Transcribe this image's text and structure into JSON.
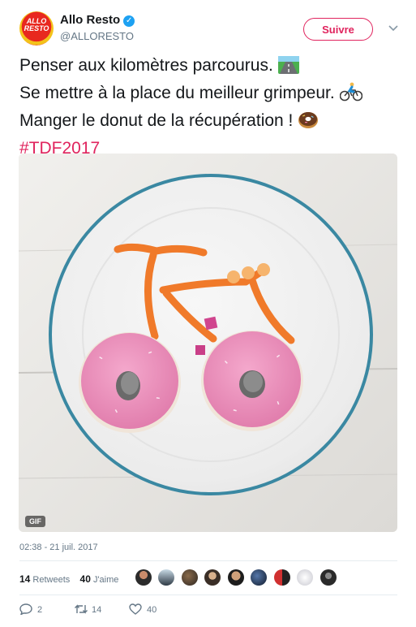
{
  "tweet": {
    "author": {
      "display_name": "Allo Resto",
      "handle": "@ALLORESTO",
      "avatar_text_1": "ALLO",
      "avatar_text_2": "RESTO",
      "verified": true
    },
    "follow_button_label": "Suivre",
    "text_lines": [
      "Penser aux kilomètres parcourus.",
      "Se mettre à la place du meilleur grimpeur.",
      "Manger le donut de la récupération !"
    ],
    "hashtag": "#TDF2017",
    "media": {
      "type": "gif",
      "badge": "GIF"
    },
    "timestamp": "02:38 - 21 juil. 2017",
    "stats": {
      "retweets_count": "14",
      "retweets_label": "Retweets",
      "likes_count": "40",
      "likes_label": "J'aime"
    },
    "liker_avatar_count": 9,
    "actions": {
      "reply_count": "2",
      "retweet_count": "14",
      "like_count": "40"
    }
  },
  "colors": {
    "accent": "#e0245e",
    "verified": "#1da1f2",
    "muted_text": "#657786",
    "brand_red": "#e8281f"
  },
  "icons": [
    "verified-badge-icon",
    "chevron-down-icon",
    "road-emoji-icon",
    "cyclist-emoji-icon",
    "donut-emoji-icon",
    "reply-icon",
    "retweet-icon",
    "like-icon"
  ]
}
